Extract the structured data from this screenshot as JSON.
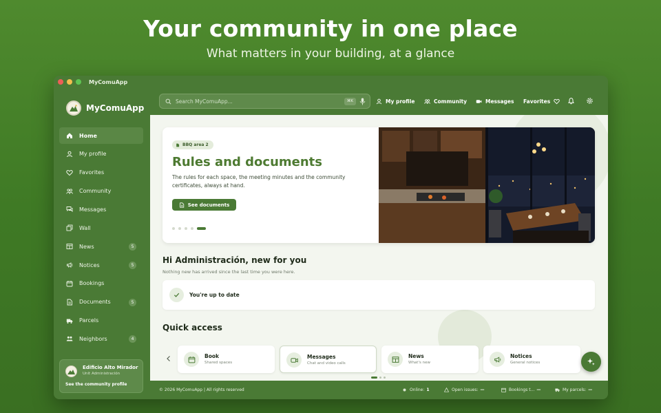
{
  "hero": {
    "title": "Your community in one place",
    "subtitle": "What matters in your building, at a glance"
  },
  "window": {
    "title": "MyComuApp"
  },
  "brand": {
    "name": "MyComuApp",
    "accent": "#4a7a35"
  },
  "sidebar": {
    "items": [
      {
        "label": "Home",
        "icon": "home-icon",
        "active": true
      },
      {
        "label": "My profile",
        "icon": "user-icon"
      },
      {
        "label": "Favorites",
        "icon": "heart-icon"
      },
      {
        "label": "Community",
        "icon": "people-icon"
      },
      {
        "label": "Messages",
        "icon": "chat-icon"
      },
      {
        "label": "Wall",
        "icon": "wall-icon"
      },
      {
        "label": "News",
        "icon": "newspaper-icon",
        "badge": "5"
      },
      {
        "label": "Notices",
        "icon": "megaphone-icon",
        "badge": "5"
      },
      {
        "label": "Bookings",
        "icon": "calendar-icon"
      },
      {
        "label": "Documents",
        "icon": "document-icon",
        "badge": "5"
      },
      {
        "label": "Parcels",
        "icon": "truck-icon"
      },
      {
        "label": "Neighbors",
        "icon": "people-icon",
        "badge": "4"
      }
    ],
    "building": {
      "name": "Edificio Alto Mirador",
      "unit": "Unit Administración",
      "link": "See the community profile"
    }
  },
  "topbar": {
    "search_placeholder": "Search MyComuApp...",
    "search_shortcut": "⌘K",
    "my_profile": "My profile",
    "community": "Community",
    "messages": "Messages",
    "favorites": "Favorites"
  },
  "banner": {
    "tag": "BBQ area 2",
    "title": "Rules and documents",
    "description": "The rules for each space, the meeting minutes and the community certificates, always at hand.",
    "button": "See documents",
    "carousel_total": 5,
    "carousel_active": 5
  },
  "greeting": {
    "title": "Hi Administración, new for you",
    "subtitle": "Nothing new has arrived since the last time you were here.",
    "status": "You're up to date"
  },
  "quick_access": {
    "title": "Quick access",
    "cards": [
      {
        "name": "Book",
        "sub": "Shared spaces",
        "icon": "calendar-icon"
      },
      {
        "name": "Messages",
        "sub": "Chat and video calls",
        "icon": "video-icon"
      },
      {
        "name": "News",
        "sub": "What's new",
        "icon": "newspaper-icon"
      },
      {
        "name": "Notices",
        "sub": "General notices",
        "icon": "megaphone-icon"
      }
    ]
  },
  "footer": {
    "copyright": "© 2026 MyComuApp | All rights reserved",
    "online_label": "Online:",
    "online_value": "1",
    "issues_label": "Open issues:",
    "issues_value": "—",
    "bookings_label": "Bookings t...",
    "bookings_value": "—",
    "parcels_label": "My parcels:",
    "parcels_value": "—"
  }
}
